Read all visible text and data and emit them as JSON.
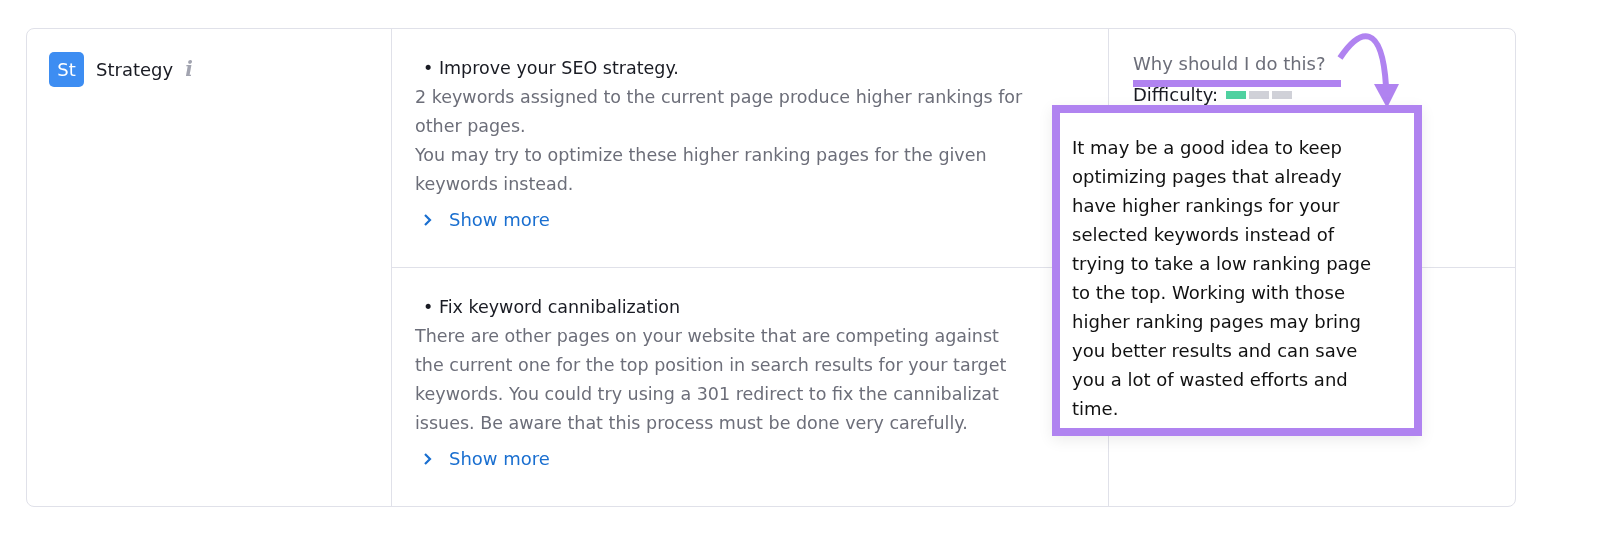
{
  "category": {
    "badge": "St",
    "label": "Strategy",
    "info_icon": "i"
  },
  "ideas": [
    {
      "title": "• Improve your SEO strategy.",
      "description": "2 keywords assigned to the current page produce higher rankings for\nother pages.\nYou may try to optimize these higher ranking pages for the given\nkeywords instead.",
      "show_more": "Show more"
    },
    {
      "title": "• Fix keyword cannibalization",
      "description": "There are other pages on your website that are competing against\nthe current one for the top position in search results for your target\nkeywords. You could try using a 301 redirect to fix the cannibalizat\nissues. Be aware that this process must be done very carefully.",
      "show_more": "Show more"
    }
  ],
  "side": {
    "why_link": "Why should I do this?",
    "difficulty_label": "Difficulty:",
    "difficulty": {
      "level": 0.33
    }
  },
  "tooltip": {
    "text": "It may be a good idea to keep\noptimizing pages that already\nhave higher rankings for your\nselected keywords instead of\ntrying to take a low ranking page\nto the top. Working with those\nhigher ranking pages may bring\nyou better results and can save\nyou a lot of wasted efforts and\ntime."
  }
}
